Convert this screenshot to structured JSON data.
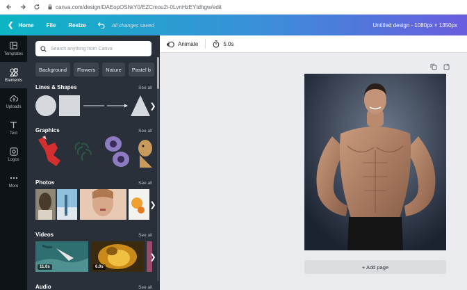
{
  "browser": {
    "url": "canva.com/design/DAEopOShkY0/EZCmou2i-0LvnHzEYtdhgw/edit"
  },
  "header": {
    "home_label": "Home",
    "file_label": "File",
    "resize_label": "Resize",
    "saved_status": "All changes saved",
    "doc_title": "Untitled design - 1080px × 1350px"
  },
  "rail": {
    "items": [
      {
        "label": "Templates",
        "icon": "templates-icon"
      },
      {
        "label": "Elements",
        "icon": "elements-icon",
        "active": true
      },
      {
        "label": "Uploads",
        "icon": "upload-cloud-icon"
      },
      {
        "label": "Text",
        "icon": "text-icon"
      },
      {
        "label": "Logos",
        "icon": "logos-icon"
      },
      {
        "label": "More",
        "icon": "more-dots-icon"
      }
    ]
  },
  "panel": {
    "search_placeholder": "Search anything from Canva",
    "chips": [
      "Background",
      "Flowers",
      "Nature",
      "Pastel b"
    ],
    "see_all": "See all",
    "sections": {
      "lines_shapes": "Lines & Shapes",
      "graphics": "Graphics",
      "photos": "Photos",
      "videos": "Videos",
      "audio": "Audio"
    },
    "videos": [
      {
        "duration": "11.0s"
      },
      {
        "duration": "6.0s"
      }
    ]
  },
  "toolbar": {
    "animate_label": "Animate",
    "duration_label": "5.0s"
  },
  "canvas": {
    "add_page_label": "+ Add page"
  },
  "colors": {
    "header_start": "#0bb5c4",
    "header_end": "#6a5ddf",
    "rail_bg": "#0e1318",
    "panel_bg": "#293039",
    "canvas_bg": "#ebecf0"
  }
}
